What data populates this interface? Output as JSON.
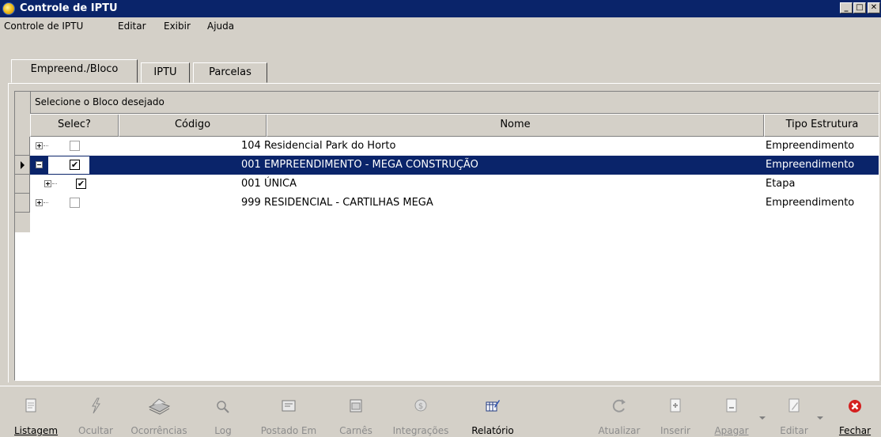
{
  "window": {
    "title": "Controle de IPTU",
    "buttons": [
      "_",
      "□",
      "✕"
    ]
  },
  "menu": [
    "Controle de IPTU",
    "Editar",
    "Exibir",
    "Ajuda"
  ],
  "tabs": [
    {
      "label": "Empreend./Bloco",
      "active": true
    },
    {
      "label": "IPTU",
      "active": false
    },
    {
      "label": "Parcelas",
      "active": false
    }
  ],
  "grid": {
    "group_label": "Selecione o Bloco desejado",
    "columns": [
      "Selec?",
      "Código",
      "Nome",
      "Tipo Estrutura"
    ],
    "rows": [
      {
        "expander": "+",
        "checked": false,
        "codigo": "",
        "nome": "104 Residencial Park do Horto",
        "tipo": "Empreendimento",
        "level": 0,
        "selected": false
      },
      {
        "expander": "−",
        "checked": true,
        "codigo": "",
        "nome": "001 EMPREENDIMENTO - MEGA CONSTRUÇÃO",
        "tipo": "Empreendimento",
        "level": 0,
        "selected": true
      },
      {
        "expander": "+",
        "checked": true,
        "codigo": "",
        "nome": "001 ÚNICA",
        "tipo": "Etapa",
        "level": 1,
        "selected": false
      },
      {
        "expander": "+",
        "checked": false,
        "codigo": "",
        "nome": "999 RESIDENCIAL - CARTILHAS MEGA",
        "tipo": "Empreendimento",
        "level": 0,
        "selected": false
      }
    ]
  },
  "toolbar": {
    "listagem": "Listagem",
    "ocultar": "Ocultar",
    "ocorrencias": "Ocorrências",
    "log": "Log",
    "postado_em": "Postado Em",
    "carnes": "Carnês",
    "integracoes": "Integrações",
    "relatorio": "Relatório",
    "atualizar": "Atualizar",
    "inserir": "Inserir",
    "apagar": "Apagar",
    "editar": "Editar",
    "fechar": "Fechar"
  },
  "colors": {
    "title_bar": "#0a246a",
    "selection": "#0a246a",
    "face": "#d4d0c8",
    "close_red": "#d42020"
  }
}
